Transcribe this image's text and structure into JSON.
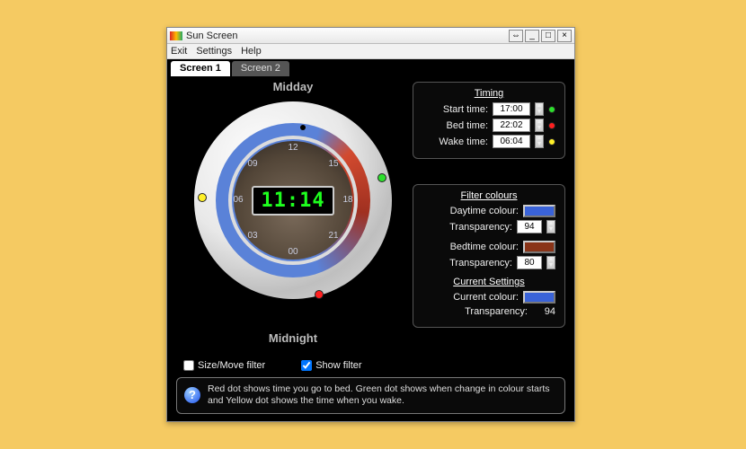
{
  "window": {
    "title": "Sun Screen"
  },
  "menubar": [
    "Exit",
    "Settings",
    "Help"
  ],
  "tabs": [
    "Screen 1",
    "Screen 2"
  ],
  "dial": {
    "top_label": "Midday",
    "bottom_label": "Midnight",
    "clock_time": "11:14",
    "hour_labels": [
      "12",
      "15",
      "18",
      "21",
      "00",
      "03",
      "06",
      "09"
    ]
  },
  "checks": {
    "size_move": {
      "label": "Size/Move filter",
      "checked": false
    },
    "show_filter": {
      "label": "Show filter",
      "checked": true
    }
  },
  "timing": {
    "heading": "Timing",
    "rows": [
      {
        "label": "Start time:",
        "value": "17:00",
        "dot": "green"
      },
      {
        "label": "Bed time:",
        "value": "22:02",
        "dot": "red"
      },
      {
        "label": "Wake time:",
        "value": "06:04",
        "dot": "yellow"
      }
    ]
  },
  "filter_colours": {
    "heading": "Filter colours",
    "daytime": {
      "label": "Daytime colour:",
      "hex": "#3a63d8",
      "transp_label": "Transparency:",
      "transparency": 94
    },
    "bedtime": {
      "label": "Bedtime colour:",
      "hex": "#8a3418",
      "transp_label": "Transparency:",
      "transparency": 80
    }
  },
  "current": {
    "heading": "Current Settings",
    "label": "Current colour:",
    "hex": "#3a63d8",
    "transp_label": "Transparency:",
    "transparency": 94
  },
  "help_text": "Red dot shows time you go to bed. Green dot shows when change in colour starts and Yellow dot shows the time when you wake."
}
